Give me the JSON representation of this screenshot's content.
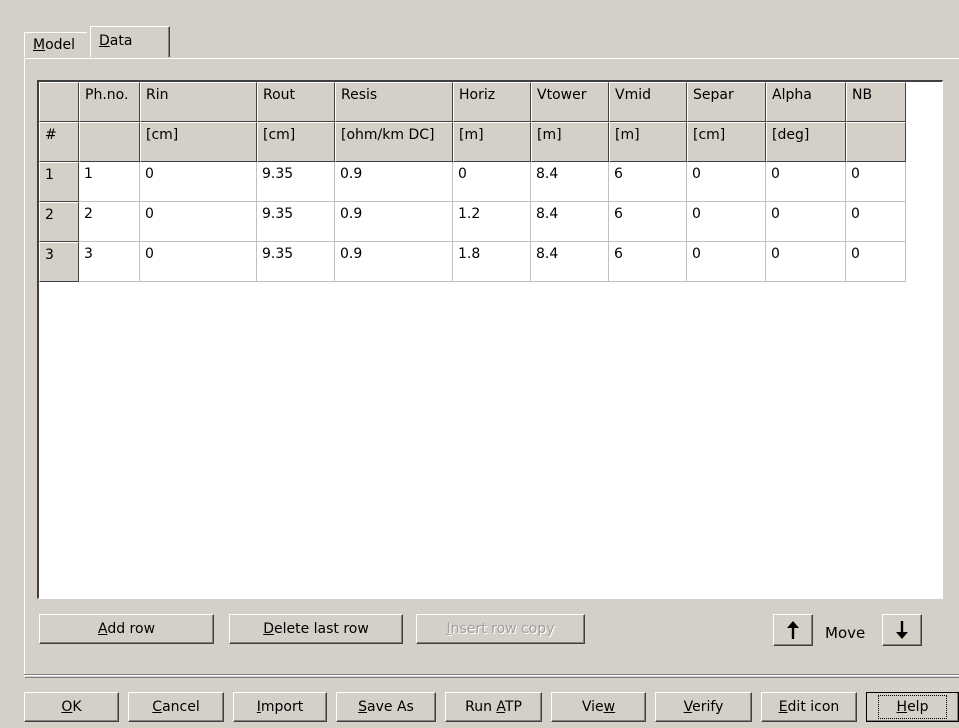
{
  "tabs": [
    {
      "label_u": "M",
      "label_rest": "odel"
    },
    {
      "label_u": "D",
      "label_rest": "ata"
    }
  ],
  "table": {
    "columns": [
      {
        "name": "",
        "unit": "#"
      },
      {
        "name": "Ph.no.",
        "unit": ""
      },
      {
        "name": "Rin",
        "unit": "[cm]"
      },
      {
        "name": "Rout",
        "unit": "[cm]"
      },
      {
        "name": "Resis",
        "unit": "[ohm/km DC]"
      },
      {
        "name": "Horiz",
        "unit": "[m]"
      },
      {
        "name": "Vtower",
        "unit": "[m]"
      },
      {
        "name": "Vmid",
        "unit": "[m]"
      },
      {
        "name": "Separ",
        "unit": "[cm]"
      },
      {
        "name": "Alpha",
        "unit": "[deg]"
      },
      {
        "name": "NB",
        "unit": ""
      }
    ],
    "rows": [
      [
        "1",
        "1",
        "0",
        "9.35",
        "0.9",
        "0",
        "8.4",
        "6",
        "0",
        "0",
        "0"
      ],
      [
        "2",
        "2",
        "0",
        "9.35",
        "0.9",
        "1.2",
        "8.4",
        "6",
        "0",
        "0",
        "0"
      ],
      [
        "3",
        "3",
        "0",
        "9.35",
        "0.9",
        "1.8",
        "8.4",
        "6",
        "0",
        "0",
        "0"
      ]
    ]
  },
  "row_buttons": {
    "add_u": "A",
    "add_rest": "dd row",
    "delete_u": "D",
    "delete_rest": "elete last row",
    "insert_u": "I",
    "insert_rest": "nsert row copy"
  },
  "move": {
    "label": "Move",
    "up_icon": "arrow-up-icon",
    "down_icon": "arrow-down-icon"
  },
  "bottom_buttons": [
    {
      "pre": "",
      "u": "O",
      "post": "K",
      "name": "ok-button"
    },
    {
      "pre": "",
      "u": "C",
      "post": "ancel",
      "name": "cancel-button"
    },
    {
      "pre": "",
      "u": "I",
      "post": "mport",
      "name": "import-button"
    },
    {
      "pre": "",
      "u": "S",
      "post": "ave As",
      "name": "save-as-button"
    },
    {
      "pre": "Run ",
      "u": "A",
      "post": "TP",
      "name": "run-atp-button"
    },
    {
      "pre": "Vie",
      "u": "w",
      "post": "",
      "name": "view-button"
    },
    {
      "pre": "",
      "u": "V",
      "post": "erify",
      "name": "verify-button"
    },
    {
      "pre": "",
      "u": "E",
      "post": "dit icon",
      "name": "edit-icon-button"
    },
    {
      "pre": "",
      "u": "H",
      "post": "elp",
      "name": "help-button"
    }
  ]
}
